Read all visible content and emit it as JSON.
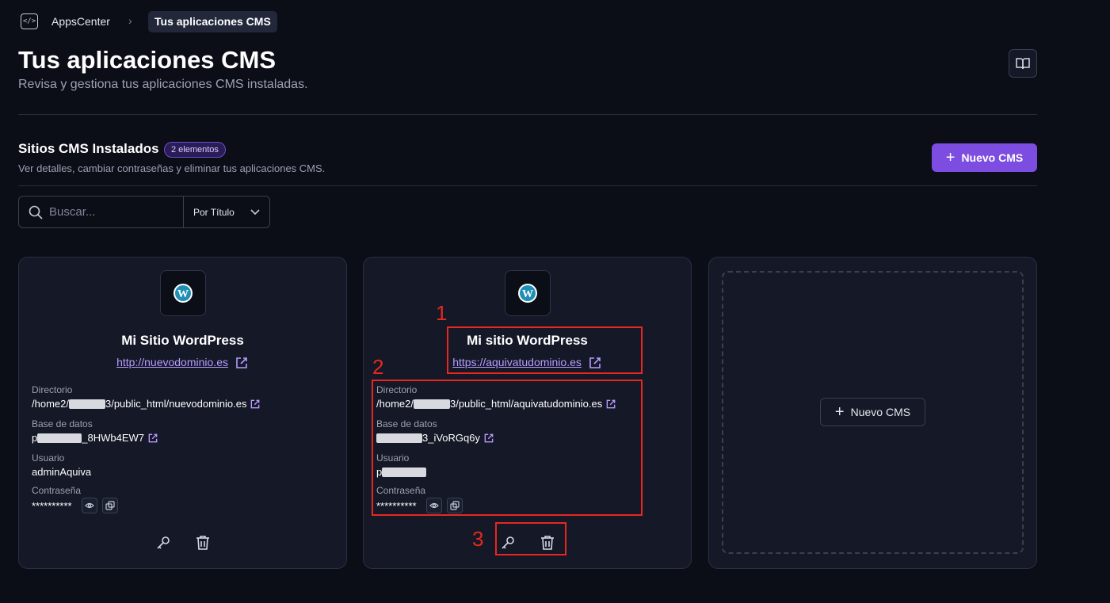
{
  "breadcrumb": {
    "app": "AppsCenter",
    "separator": "›",
    "current": "Tus aplicaciones CMS"
  },
  "header": {
    "title": "Tus aplicaciones CMS",
    "subtitle": "Revisa y gestiona tus aplicaciones CMS instaladas."
  },
  "section": {
    "title": "Sitios CMS Instalados",
    "badge": "2 elementos",
    "subtitle": "Ver detalles, cambiar contraseñas y eliminar tus aplicaciones CMS.",
    "new_button": "Nuevo CMS"
  },
  "filters": {
    "search_placeholder": "Buscar...",
    "sort_label": "Por Título"
  },
  "labels": {
    "directory": "Directorio",
    "database": "Base de datos",
    "user": "Usuario",
    "password": "Contraseña"
  },
  "cards": [
    {
      "name": "Mi Sitio WordPress",
      "url": "http://nuevodominio.es",
      "dir_prefix": "/home2/",
      "dir_suffix": "3/public_html/nuevodominio.es",
      "db_prefix": "p",
      "db_suffix": "_8HWb4EW7",
      "user": "adminAquiva",
      "password": "**********"
    },
    {
      "name": "Mi sitio WordPress",
      "url": "https://aquivatudominio.es",
      "dir_prefix": "/home2/",
      "dir_suffix": "3/public_html/aquivatudominio.es",
      "db_prefix": "",
      "db_suffix": "3_iVoRGq6y",
      "user_prefix": "p",
      "password": "**********"
    }
  ],
  "empty_card": {
    "button": "Nuevo CMS"
  },
  "annotations": [
    "1",
    "2",
    "3"
  ],
  "colors": {
    "accent": "#7c4de0",
    "annotation": "#e8281f",
    "link": "#b79cff",
    "background": "#0b0d17"
  }
}
